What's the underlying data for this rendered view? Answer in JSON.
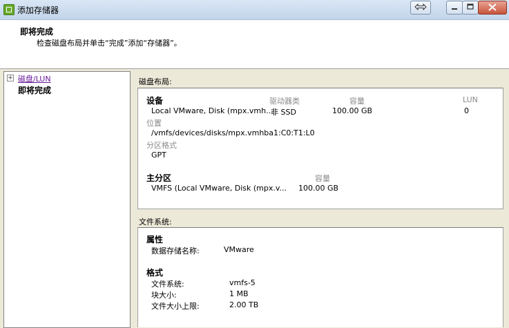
{
  "window": {
    "title": "添加存储器",
    "buttons": {
      "restore": "⇔",
      "minimize": "",
      "maximize": "",
      "close": ""
    }
  },
  "header": {
    "title": "即将完成",
    "description": "检查磁盘布局并单击“完成”添加“存储器”。"
  },
  "nav": {
    "expand_glyph": "+",
    "link": "磁盘/LUN",
    "current": "即将完成"
  },
  "disk_layout": {
    "label": "磁盘布局:",
    "device_header": "设备",
    "drive_type_header": "驱动器类",
    "capacity_header": "容量",
    "lun_header": "LUN",
    "device": "Local VMware, Disk (mpx.vmh...",
    "drive_type": "非 SSD",
    "capacity": "100.00 GB",
    "lun": "0",
    "location_label": "位置",
    "location": "/vmfs/devices/disks/mpx.vmhba1:C0:T1:L0",
    "partition_format_label": "分区格式",
    "partition_format": "GPT",
    "primary_partition_header": "主分区",
    "primary_capacity_header": "容量",
    "primary_partition": "VMFS (Local VMware, Disk (mpx.v...",
    "primary_capacity": "100.00 GB"
  },
  "file_system": {
    "label": "文件系统:",
    "properties_header": "属性",
    "datastore_name_label": "数据存储名称:",
    "datastore_name": "VMware",
    "format_header": "格式",
    "fs_label": "文件系统:",
    "fs_value": "vmfs-5",
    "block_size_label": "块大小:",
    "block_size": "1 MB",
    "max_file_size_label": "文件大小上限:",
    "max_file_size": "2.00 TB"
  }
}
